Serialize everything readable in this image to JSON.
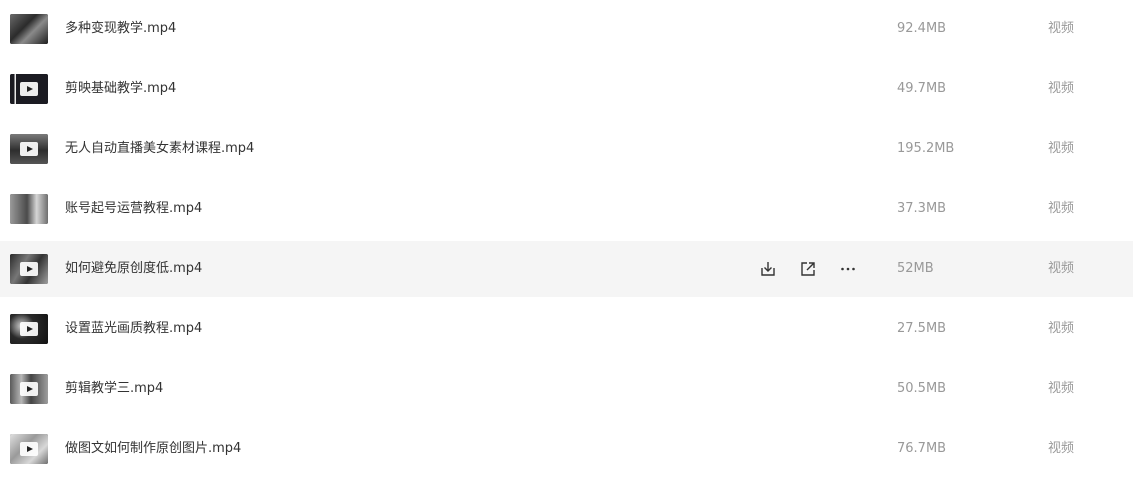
{
  "files": [
    {
      "name": "多种变现教学.mp4",
      "size": "92.4MB",
      "type": "视频",
      "thumbnail_icon": "video-thumbnail",
      "play_overlay": false
    },
    {
      "name": "剪映基础教学.mp4",
      "size": "49.7MB",
      "type": "视频",
      "thumbnail_icon": "video-thumbnail",
      "play_overlay": true
    },
    {
      "name": "无人自动直播美女素材课程.mp4",
      "size": "195.2MB",
      "type": "视频",
      "thumbnail_icon": "video-thumbnail",
      "play_overlay": true
    },
    {
      "name": "账号起号运营教程.mp4",
      "size": "37.3MB",
      "type": "视频",
      "thumbnail_icon": "video-thumbnail",
      "play_overlay": false
    },
    {
      "name": "如何避免原创度低.mp4",
      "size": "52MB",
      "type": "视频",
      "thumbnail_icon": "video-thumbnail",
      "play_overlay": true,
      "hovered": true
    },
    {
      "name": "设置蓝光画质教程.mp4",
      "size": "27.5MB",
      "type": "视频",
      "thumbnail_icon": "video-thumbnail",
      "play_overlay": true
    },
    {
      "name": "剪辑教学三.mp4",
      "size": "50.5MB",
      "type": "视频",
      "thumbnail_icon": "video-thumbnail",
      "play_overlay": true
    },
    {
      "name": "做图文如何制作原创图片.mp4",
      "size": "76.7MB",
      "type": "视频",
      "thumbnail_icon": "video-thumbnail",
      "play_overlay": true
    }
  ],
  "hover_actions": [
    "download-icon",
    "share-icon",
    "more-icon"
  ],
  "colors": {
    "hover_background": "#f5f5f5",
    "name_text": "#333333",
    "meta_text": "#999999",
    "icon": "#333333"
  }
}
